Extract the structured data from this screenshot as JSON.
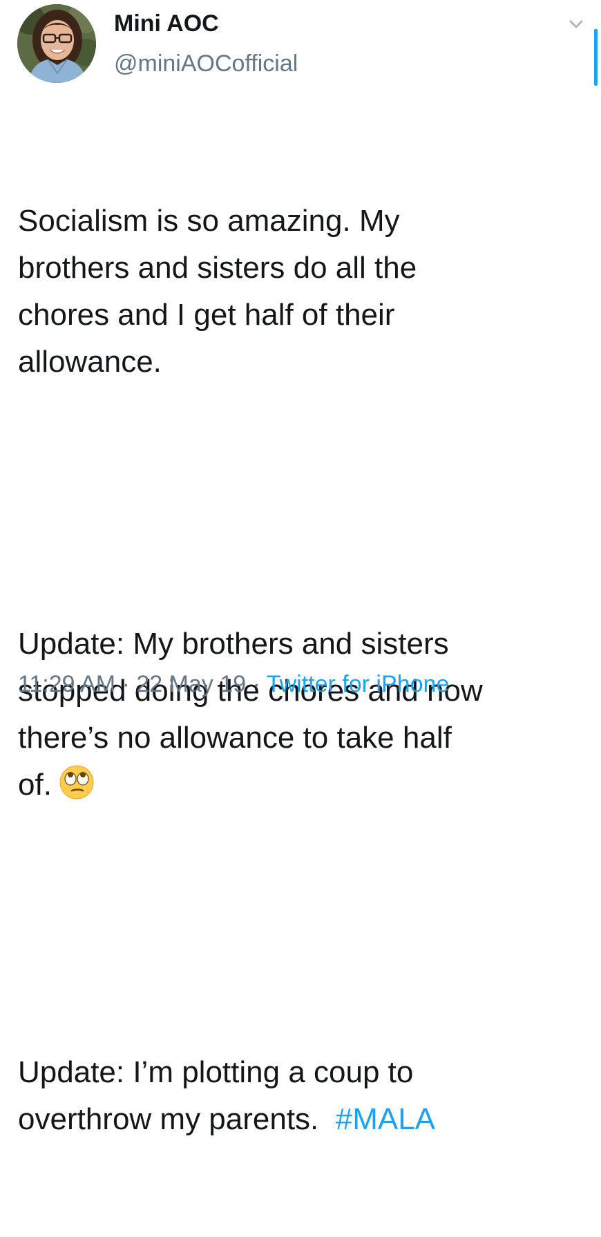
{
  "author": {
    "display_name": "Mini AOC",
    "handle": "@miniAOCofficial",
    "avatar_icon": "profile-photo-avatar"
  },
  "tweet": {
    "paragraph1": "Socialism is so amazing. My\nbrothers and sisters do all the\nchores and I get half of their\nallowance.",
    "paragraph2": "Update: My brothers and sisters\nstopped doing the chores and now\nthere’s no allowance to take half\nof.",
    "paragraph2_emoji": "face-with-rolling-eyes-emoji",
    "paragraph3": "Update: I’m plotting a coup to\noverthrow my parents.",
    "hashtag": "#MALA"
  },
  "meta": {
    "time": "11:29 AM",
    "separator1": " · ",
    "date": "22 May 19",
    "separator2": " · ",
    "source": "Twitter for iPhone"
  },
  "colors": {
    "link": "#1da1f2",
    "secondary_text": "#657786",
    "primary_text": "#14171a"
  },
  "icons": {
    "chevron": "chevron-down-icon"
  }
}
